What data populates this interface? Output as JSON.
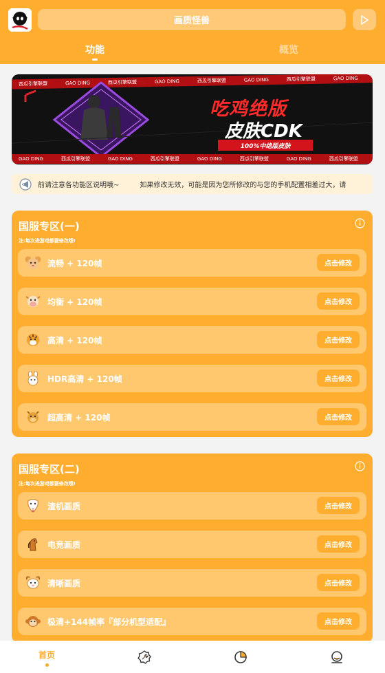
{
  "header": {
    "title": "画质怪兽",
    "tabs": [
      {
        "label": "功能",
        "active": true
      },
      {
        "label": "概览",
        "active": false
      }
    ]
  },
  "banner": {
    "title_line1": "吃鸡绝版",
    "title_line2": "皮肤CDK",
    "tag": "100%中绝版皮肤",
    "strip_texts": [
      "西瓜引擎联盟",
      "GAO DING",
      "西瓜引擎联盟",
      "GAO DING",
      "西瓜引擎联盟",
      "GAO DING",
      "西瓜引擎联盟",
      "GAO DING",
      "西瓜引擎联盟"
    ]
  },
  "notice": {
    "text1": "前请注意各功能区说明哦~",
    "text2": "如果修改无效，可能是因为您所修改的与您的手机配置相差过大，请"
  },
  "sections": [
    {
      "title": "国服专区(一)",
      "note": "注:每次进游戏都要修改哦!",
      "rows": [
        {
          "icon": "mouse-icon",
          "label": "流畅 + 120帧",
          "button": "点击修改"
        },
        {
          "icon": "cow-icon",
          "label": "均衡 + 120帧",
          "button": "点击修改"
        },
        {
          "icon": "tiger-icon",
          "label": "高清 + 120帧",
          "button": "点击修改"
        },
        {
          "icon": "rabbit-icon",
          "label": "HDR高清 + 120帧",
          "button": "点击修改"
        },
        {
          "icon": "dragon-icon",
          "label": "超高清 + 120帧",
          "button": "点击修改"
        }
      ]
    },
    {
      "title": "国服专区(二)",
      "note": "注:每次进游戏都要修改哦!",
      "rows": [
        {
          "icon": "snake-icon",
          "label": "渣机画质",
          "button": "点击修改"
        },
        {
          "icon": "horse-icon",
          "label": "电竞画质",
          "button": "点击修改"
        },
        {
          "icon": "goat-icon",
          "label": "清晰画质",
          "button": "点击修改"
        },
        {
          "icon": "monkey-icon",
          "label": "极清+144帧率『部分机型适配』",
          "button": "点击修改"
        }
      ]
    }
  ],
  "bottom_nav": {
    "home_label": "首页"
  },
  "colors": {
    "accent": "#ffad2e",
    "row_bg": "#ffc86e",
    "page_bg": "#f3f3f3"
  }
}
